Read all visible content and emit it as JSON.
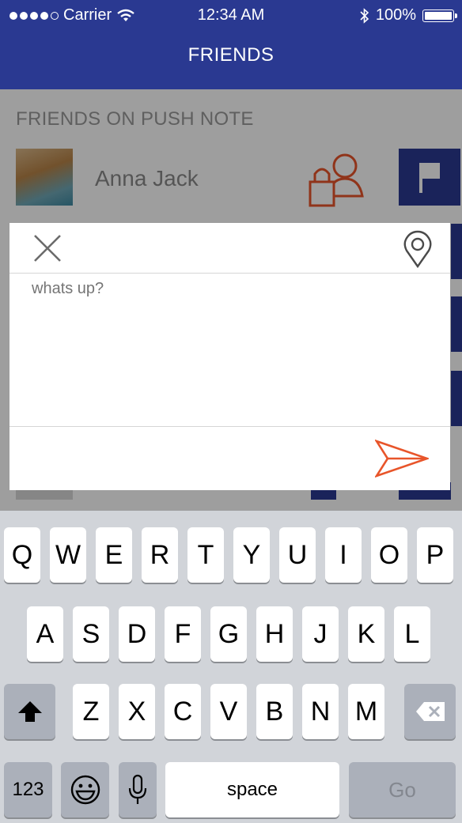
{
  "status_bar": {
    "carrier": "Carrier",
    "time": "12:34 AM",
    "battery": "100%"
  },
  "header": {
    "title": "FRIENDS"
  },
  "list": {
    "section_label": "FRIENDS ON PUSH NOTE",
    "friends": [
      {
        "name": "Anna Jack"
      }
    ]
  },
  "compose": {
    "placeholder": "whats up?",
    "accent_color": "#e8552a"
  },
  "keyboard": {
    "row1": [
      "Q",
      "W",
      "E",
      "R",
      "T",
      "Y",
      "U",
      "I",
      "O",
      "P"
    ],
    "row2": [
      "A",
      "S",
      "D",
      "F",
      "G",
      "H",
      "J",
      "K",
      "L"
    ],
    "row3": [
      "Z",
      "X",
      "C",
      "V",
      "B",
      "N",
      "M"
    ],
    "numbers_label": "123",
    "space_label": "space",
    "go_label": "Go"
  },
  "colors": {
    "brand": "#2a3991",
    "keyboard_bg": "#d1d4d9"
  }
}
